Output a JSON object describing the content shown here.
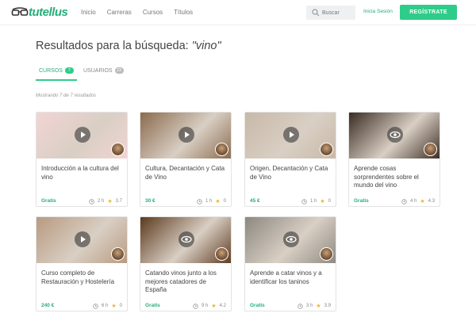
{
  "header": {
    "brand": "tutellus",
    "nav": [
      "Inicio",
      "Carreras",
      "Cursos",
      "Títulos"
    ],
    "search_placeholder": "Buscar",
    "login_label": "Inicia Sesión",
    "register_label": "REGÍSTRATE"
  },
  "results": {
    "title_prefix": "Resultados para la búsqueda: ",
    "query": "\"vino\"",
    "tabs": [
      {
        "label": "CURSOS",
        "count": "7"
      },
      {
        "label": "USUARIOS",
        "count": "23"
      }
    ],
    "showing": "Mostrando 7 de 7 resultados"
  },
  "cards": [
    {
      "title": "Introducción a la cultura del vino",
      "price": "Gratis",
      "hours": "2 h",
      "rating": "3.7",
      "media": "play",
      "thumb_color": "#f2d4d4"
    },
    {
      "title": "Cultura, Decantación y Cata de Vino",
      "price": "30 €",
      "hours": "1 h",
      "rating": "0",
      "media": "play",
      "thumb_color": "#8a6b4e"
    },
    {
      "title": "Origen, Decantación y Cata de Vino",
      "price": "45 €",
      "hours": "1 h",
      "rating": "0",
      "media": "play",
      "thumb_color": "#c8b9a8"
    },
    {
      "title": "Aprende cosas sorprendentes sobre el mundo del vino",
      "price": "Gratis",
      "hours": "4 h",
      "rating": "4.3",
      "media": "eye",
      "thumb_color": "#3a2c22"
    },
    {
      "title": "Curso completo de Restauración y Hostelería",
      "price": "240 €",
      "hours": "6 h",
      "rating": "0",
      "media": "play",
      "thumb_color": "#b89a80"
    },
    {
      "title": "Catando vinos junto a los mejores catadores de España",
      "price": "Gratis",
      "hours": "9 h",
      "rating": "4.2",
      "media": "eye",
      "thumb_color": "#5c3a1e"
    },
    {
      "title": "Aprende a catar vinos y a identificar los taninos",
      "price": "Gratis",
      "hours": "3 h",
      "rating": "3.9",
      "media": "eye",
      "thumb_color": "#8c8880"
    }
  ],
  "colors": {
    "accent": "#2ecc8a",
    "accent_text": "#27ae7a"
  }
}
